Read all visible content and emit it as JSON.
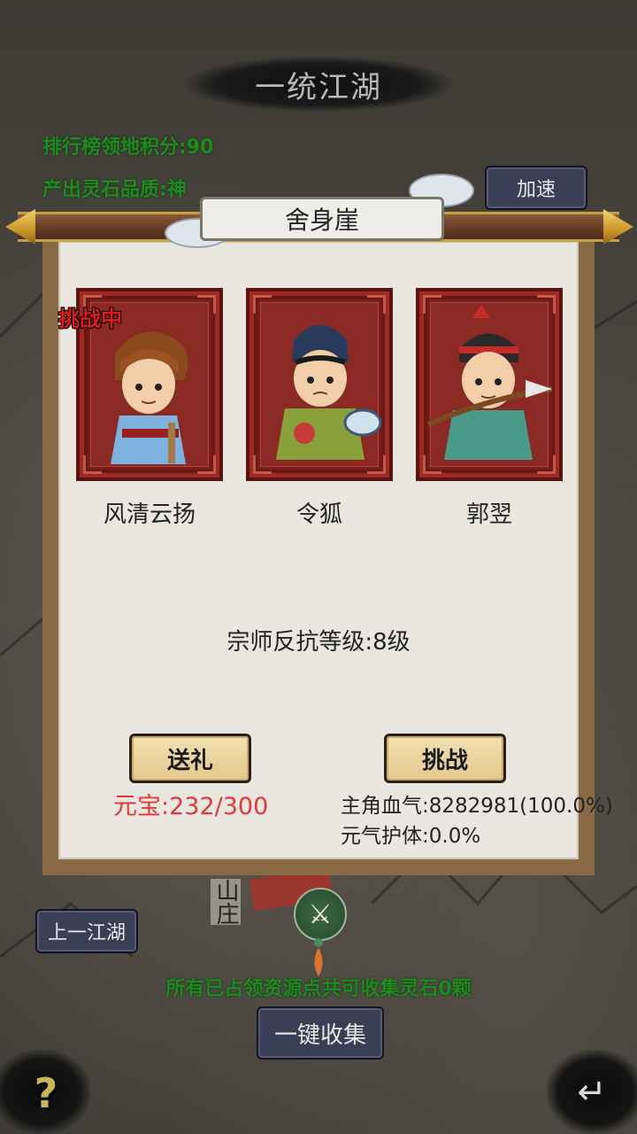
{
  "header": {
    "title": "一统江湖",
    "leaderboard_points": "排行榜领地积分:90",
    "stone_quality": "产出灵石品质:神",
    "speed_button": "加速"
  },
  "dialog": {
    "location_title": "舍身崖",
    "challenging_badge": "挑战中",
    "characters": [
      {
        "name": "风清云扬"
      },
      {
        "name": "令狐"
      },
      {
        "name": "郭翌"
      }
    ],
    "master_resistance": "宗师反抗等级:8级",
    "gift_button": "送礼",
    "challenge_button": "挑战",
    "ingots": "元宝:232/300",
    "hero_hp": "主角血气:8282981(100.0%)",
    "shield": "元气护体:0.0%"
  },
  "map": {
    "place_label": "山庄",
    "prev_button": "上一江湖",
    "notice": "所有已占领资源点共可收集灵石0颗",
    "collect_all_button": "一键收集"
  },
  "icons": {
    "help": "?",
    "back": "↵",
    "battle": "⚔"
  },
  "colors": {
    "info_green": "#1f8a1f",
    "ingot_red": "#e2383a",
    "challenging_red": "#e01b1b"
  }
}
